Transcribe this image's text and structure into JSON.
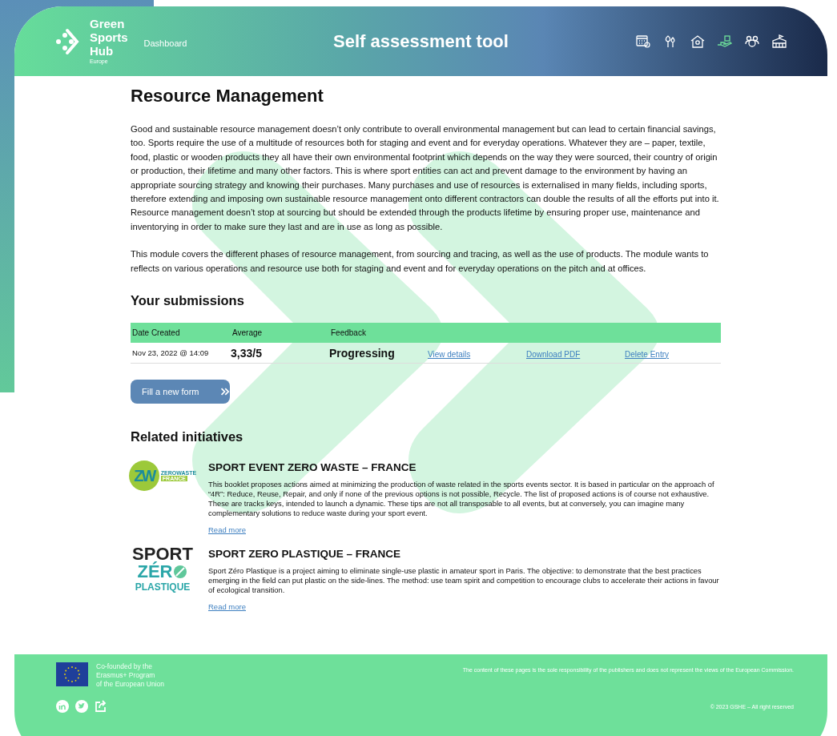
{
  "header": {
    "logo": {
      "lines": [
        "Green",
        "Sports",
        "Hub"
      ],
      "sub": "Europe"
    },
    "nav_link": "Dashboard",
    "title": "Self assessment tool",
    "nav_icons": [
      {
        "kind": "calendar",
        "selected": false
      },
      {
        "kind": "trees",
        "selected": false
      },
      {
        "kind": "house",
        "selected": false
      },
      {
        "kind": "hand",
        "selected": true
      },
      {
        "kind": "people",
        "selected": false
      },
      {
        "kind": "stadium",
        "selected": false
      }
    ]
  },
  "page": {
    "title": "Resource Management",
    "paragraphs": [
      "Good and sustainable resource management doesn’t only contribute to overall environmental management but can lead to certain financial savings, too. Sports require the use of a multitude of resources both for staging and event and for everyday operations. Whatever they are – paper, textile, food, plastic or wooden products they all have their own environmental footprint which depends on the way they were sourced, their country of origin or production, their lifetime and many other factors. This is where sport entities can act and prevent damage to the environment by having an appropriate sourcing strategy and knowing their purchases. Many purchases and use of resources is externalised in many fields, including sports, therefore extending and imposing own sustainable resource management onto different contractors can double the results of all the efforts put into it. Resource management doesn’t stop at sourcing but should be extended through the products lifetime by ensuring proper use, maintenance and inventorying in order to make sure they last and are in use as long as possible.",
      "This module covers the different phases of resource management, from sourcing and tracing, as well as the use of products. The module wants to reflects on various operations and resource use both for staging and event and for everyday operations on the pitch and at offices."
    ]
  },
  "submissions": {
    "title": "Your submissions",
    "columns": [
      "Date Created",
      "Average",
      "Feedback"
    ],
    "rows": [
      {
        "date": "Nov 23, 2022 @ 14:09",
        "average": "3,33/5",
        "feedback": "Progressing",
        "links": [
          "View details",
          "Download PDF",
          "Delete Entry"
        ]
      }
    ],
    "button": "Fill a new form"
  },
  "related": {
    "title": "Related initiatives",
    "items": [
      {
        "logo": {
          "kind": "zerowaste",
          "texts": [
            "ZW",
            "ZEROWASTE",
            "FRANCE"
          ]
        },
        "title": "SPORT EVENT ZERO WASTE – FRANCE",
        "text": "This booklet proposes actions aimed at minimizing the production of waste related in the sports events sector. It is based in particular on the approach of “4R”: Reduce, Reuse, Repair, and only if none of the previous options is not possible, Recycle. The list of proposed actions is of course not exhaustive. These are tracks keys, intended to launch a dynamic. These tips are not all transposable to all events, but at conversely, you can imagine many complementary solutions to reduce waste during your sport event.",
        "link": "Read more"
      },
      {
        "logo": {
          "kind": "plastique",
          "texts": [
            "SPORT",
            "ZÉR",
            "PLASTIQUE"
          ]
        },
        "title": "SPORT ZERO PLASTIQUE – FRANCE",
        "text": "Sport Zéro Plastique is a project aiming to eliminate single-use plastic in amateur sport in Paris. The objective: to demonstrate that the best practices emerging in the field can put plastic on the side-lines. The method: use team spirit and competition to encourage clubs to accelerate their actions in favour of ecological transition.",
        "link": "Read more"
      }
    ]
  },
  "footer": {
    "funding": [
      "Co-founded by the",
      "Erasmus+ Program",
      "of the European Union"
    ],
    "disclaimer": "The content of these pages is the sole responsibility of the publishers and does not represent the views of the European Commission.",
    "social": [
      {
        "kind": "linkedin"
      },
      {
        "kind": "twitter"
      },
      {
        "kind": "share"
      }
    ],
    "copyright": "© 2023 GSHE – All right reserved"
  }
}
